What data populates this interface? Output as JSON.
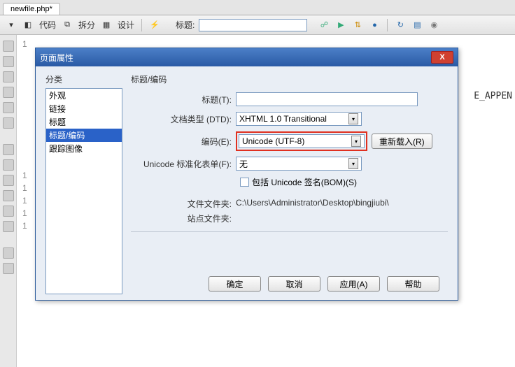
{
  "tab": {
    "filename": "newfile.php*"
  },
  "toolbar": {
    "code_label": "代码",
    "split_label": "拆分",
    "design_label": "设计",
    "title_label": "标题:"
  },
  "background": {
    "code_fragment": "E_APPEN"
  },
  "dialog": {
    "title": "页面属性",
    "close": "X",
    "categories_label": "分类",
    "categories": [
      "外观",
      "链接",
      "标题",
      "标题/编码",
      "跟踪图像"
    ],
    "selected_category_index": 3,
    "section_label": "标题/编码",
    "title_field_label": "标题(T):",
    "title_value": "",
    "dtd_label": "文档类型 (DTD):",
    "dtd_value": "XHTML 1.0 Transitional",
    "encoding_label": "编码(E):",
    "encoding_value": "Unicode (UTF-8)",
    "reload_btn": "重新载入(R)",
    "normform_label": "Unicode 标准化表单(F):",
    "normform_value": "无",
    "bom_checkbox": "包括 Unicode 签名(BOM)(S)",
    "filefolder_label": "文件文件夹:",
    "filefolder_value": "C:\\Users\\Administrator\\Desktop\\bingjiubi\\",
    "sitefolder_label": "站点文件夹:",
    "sitefolder_value": "",
    "buttons": {
      "ok": "确定",
      "cancel": "取消",
      "apply": "应用(A)",
      "help": "帮助"
    }
  }
}
